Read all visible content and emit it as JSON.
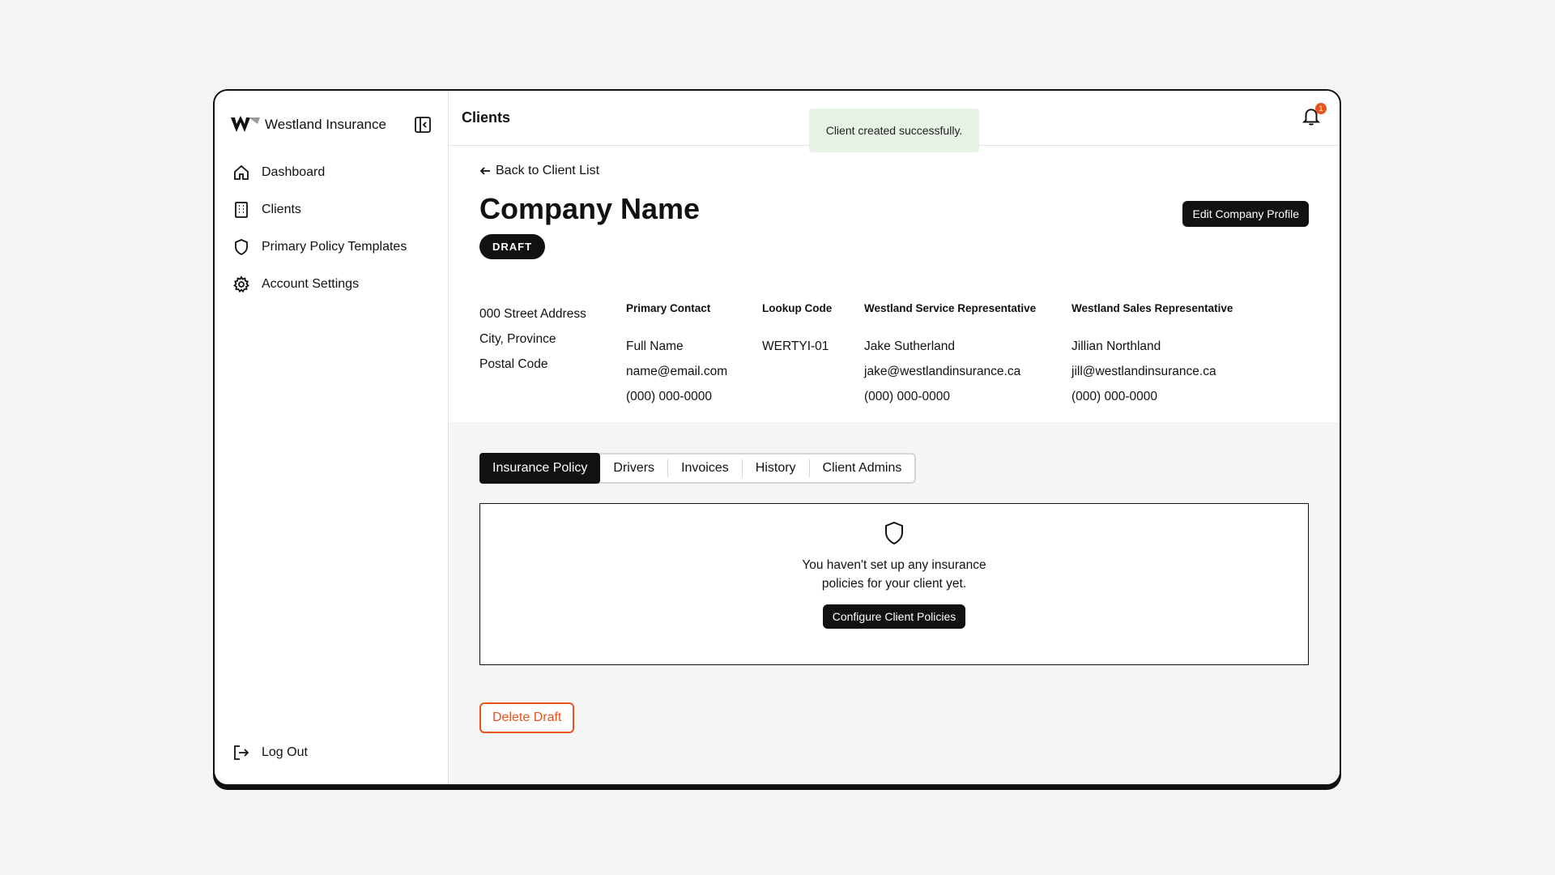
{
  "brand": {
    "name": "Westland Insurance"
  },
  "sidebar": {
    "items": [
      {
        "label": "Dashboard",
        "icon": "home-icon"
      },
      {
        "label": "Clients",
        "icon": "building-icon"
      },
      {
        "label": "Primary Policy Templates",
        "icon": "shield-icon"
      },
      {
        "label": "Account Settings",
        "icon": "gear-icon"
      }
    ],
    "logout_label": "Log Out"
  },
  "topbar": {
    "title": "Clients",
    "toast": "Client created successfully.",
    "notification_count": "1"
  },
  "client": {
    "back_label": "Back to Client List",
    "title": "Company Name",
    "status": "DRAFT",
    "edit_label": "Edit Company Profile",
    "address": {
      "line1": "000 Street Address",
      "line2": "City, Province",
      "line3": "Postal Code"
    },
    "primary_contact": {
      "heading": "Primary Contact",
      "name": "Full Name",
      "email": "name@email.com",
      "phone": "(000) 000-0000"
    },
    "lookup": {
      "heading": "Lookup Code",
      "code": "WERTYI-01"
    },
    "service_rep": {
      "heading": "Westland Service Representative",
      "name": "Jake Sutherland",
      "email": "jake@westlandinsurance.ca",
      "phone": "(000) 000-0000"
    },
    "sales_rep": {
      "heading": "Westland Sales Representative",
      "name": "Jillian Northland",
      "email": "jill@westlandinsurance.ca",
      "phone": "(000) 000-0000"
    }
  },
  "tabs": [
    {
      "label": "Insurance Policy",
      "active": true
    },
    {
      "label": "Drivers"
    },
    {
      "label": "Invoices"
    },
    {
      "label": "History"
    },
    {
      "label": "Client Admins"
    }
  ],
  "empty_state": {
    "message": "You haven't set up any insurance policies for your client yet.",
    "button_label": "Configure Client Policies"
  },
  "delete_label": "Delete Draft",
  "colors": {
    "accent": "#e8541e",
    "toast_bg": "#e6f2e4",
    "primary": "#111111"
  }
}
